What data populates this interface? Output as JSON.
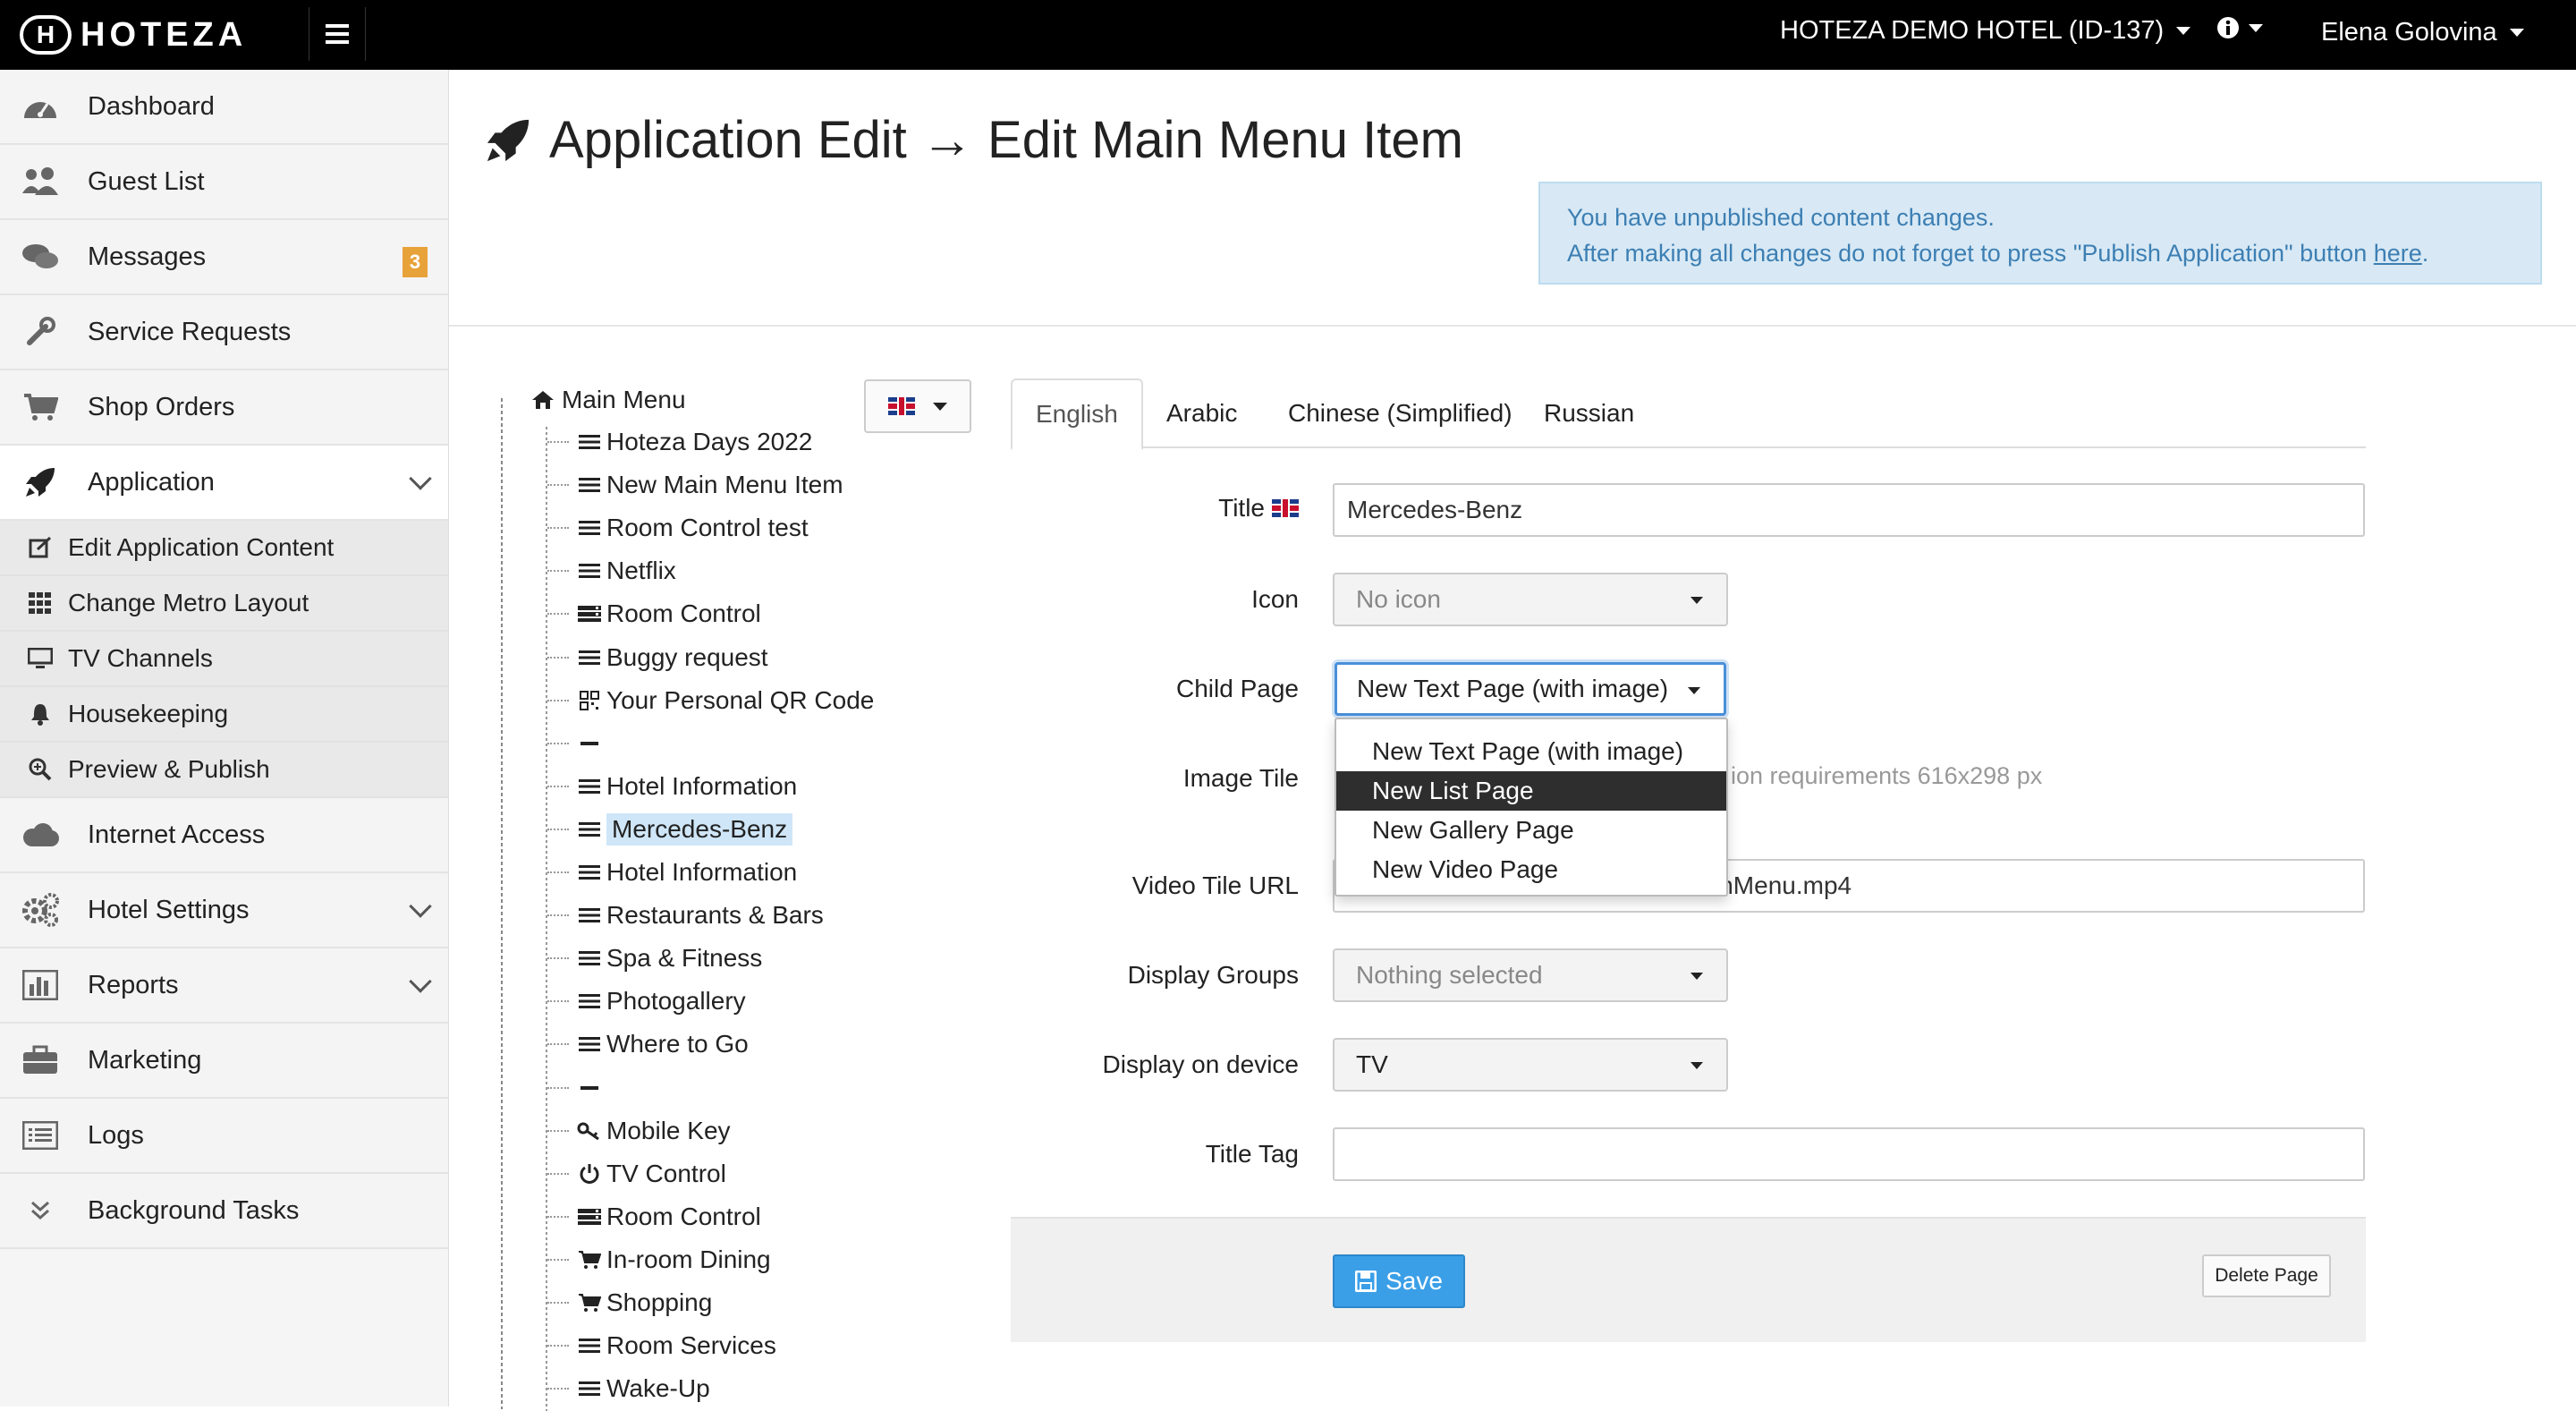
{
  "topbar": {
    "logo_mark": "H",
    "logo_text": "HOTEZA",
    "hotel": "HOTEZA DEMO HOTEL (ID-137)",
    "user": "Elena Golovina"
  },
  "sidebar": {
    "items": [
      {
        "label": "Dashboard",
        "icon": "dashboard-icon"
      },
      {
        "label": "Guest List",
        "icon": "users-icon"
      },
      {
        "label": "Messages",
        "icon": "comments-icon",
        "badge": "3"
      },
      {
        "label": "Service Requests",
        "icon": "wrench-icon"
      },
      {
        "label": "Shop Orders",
        "icon": "cart-icon"
      },
      {
        "label": "Application",
        "icon": "rocket-icon"
      }
    ],
    "subitems": [
      {
        "label": "Edit Application Content",
        "icon": "edit-icon"
      },
      {
        "label": "Change Metro Layout",
        "icon": "grid-icon"
      },
      {
        "label": "TV Channels",
        "icon": "monitor-icon"
      },
      {
        "label": "Housekeeping",
        "icon": "bell-icon"
      },
      {
        "label": "Preview & Publish",
        "icon": "search-plus-icon"
      }
    ],
    "items2": [
      {
        "label": "Internet Access",
        "icon": "cloud-icon"
      },
      {
        "label": "Hotel Settings",
        "icon": "cogs-icon"
      },
      {
        "label": "Reports",
        "icon": "bar-chart-icon"
      },
      {
        "label": "Marketing",
        "icon": "briefcase-icon"
      },
      {
        "label": "Logs",
        "icon": "list-icon"
      },
      {
        "label": "Background Tasks",
        "icon": "double-chevron-down-icon"
      }
    ]
  },
  "page": {
    "title": "Application Edit → Edit Main Menu Item",
    "alert_line1": "You have unpublished content changes.",
    "alert_line2": "After making all changes do not forget to press \"Publish Application\" button ",
    "alert_link": "here",
    "alert_end": "."
  },
  "tree": {
    "root": "Main Menu",
    "items": [
      {
        "label": "Hoteza Days 2022",
        "icon": "bars"
      },
      {
        "label": "New Main Menu Item",
        "icon": "bars"
      },
      {
        "label": "Room Control test",
        "icon": "bars"
      },
      {
        "label": "Netflix",
        "icon": "bars"
      },
      {
        "label": "Room Control",
        "icon": "server"
      },
      {
        "label": "Buggy request",
        "icon": "bars"
      },
      {
        "label": "Your Personal QR Code",
        "icon": "qrcode"
      },
      {
        "label": "",
        "icon": "minus"
      },
      {
        "label": "Hotel Information",
        "icon": "bars"
      },
      {
        "label": "Mercedes-Benz",
        "icon": "bars",
        "selected": true
      },
      {
        "label": "Hotel Information",
        "icon": "bars"
      },
      {
        "label": "Restaurants & Bars",
        "icon": "bars"
      },
      {
        "label": "Spa & Fitness",
        "icon": "bars"
      },
      {
        "label": "Photogallery",
        "icon": "bars"
      },
      {
        "label": "Where to Go",
        "icon": "bars"
      },
      {
        "label": "",
        "icon": "minus"
      },
      {
        "label": "Mobile Key",
        "icon": "key"
      },
      {
        "label": "TV Control",
        "icon": "power"
      },
      {
        "label": "Room Control",
        "icon": "server"
      },
      {
        "label": "In-room Dining",
        "icon": "cart"
      },
      {
        "label": "Shopping",
        "icon": "cart"
      },
      {
        "label": "Room Services",
        "icon": "bars"
      },
      {
        "label": "Wake-Up",
        "icon": "bars"
      }
    ]
  },
  "tabs": [
    "English",
    "Arabic",
    "Chinese (Simplified)",
    "Russian"
  ],
  "form": {
    "title_label": "Title",
    "title_value": "Mercedes-Benz",
    "icon_label": "Icon",
    "icon_value": "No icon",
    "child_label": "Child Page",
    "child_value": "New Text Page (with image)",
    "image_label": "Image Tile",
    "image_hint": "ion requirements 616x298 px",
    "video_label": "Video Tile URL",
    "video_value": "inMenu.mp4",
    "groups_label": "Display Groups",
    "groups_value": "Nothing selected",
    "device_label": "Display on device",
    "device_value": "TV",
    "tag_label": "Title Tag",
    "tag_value": ""
  },
  "dropdown": {
    "options": [
      "New Text Page (with image)",
      "New List Page",
      "New Gallery Page",
      "New Video Page"
    ],
    "highlighted": "New List Page"
  },
  "footer": {
    "save": "Save",
    "delete": "Delete Page"
  },
  "colors": {
    "accent": "#3b9fe8",
    "badge": "#e8a23a",
    "alert_bg": "#d8e9f5",
    "alert_text": "#3d7fb3"
  }
}
